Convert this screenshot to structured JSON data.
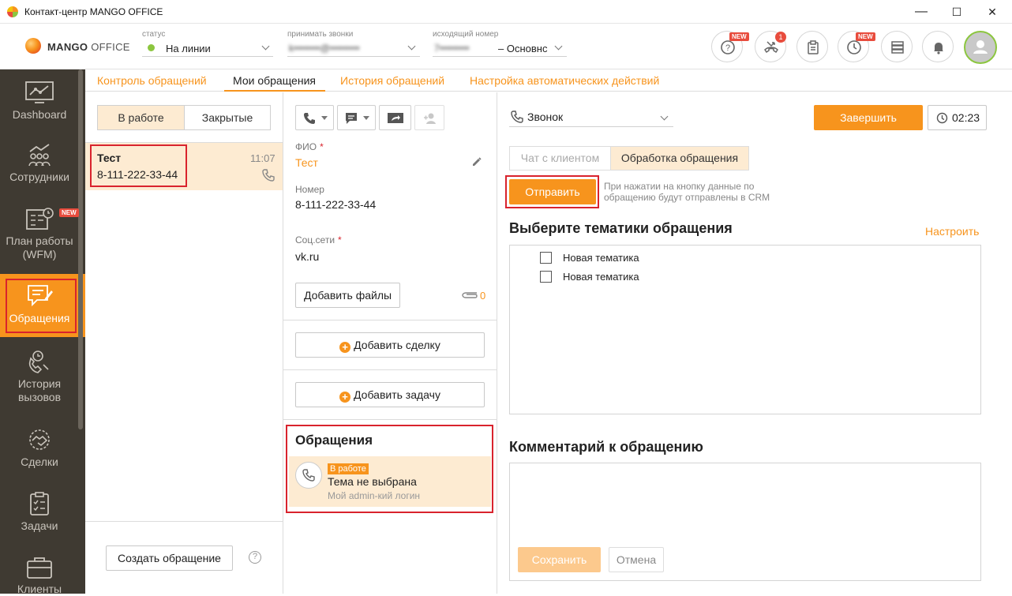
{
  "window": {
    "title": "Контакт-центр MANGO OFFICE",
    "minimize": "—",
    "maximize": "☐",
    "close": "✕"
  },
  "header": {
    "logo_brand": "MANGO",
    "logo_suffix": "OFFICE",
    "status_label": "статус",
    "status_value": "На линии",
    "status_color": "#8cc63f",
    "accept_label": "принимать звонки",
    "accept_value": "k••••••••@•••••••••",
    "outgoing_label": "исходящий номер",
    "outgoing_number": "7•••••••••",
    "outgoing_value": "– Основнс",
    "new_badge": "NEW",
    "missed_count": "1"
  },
  "sidebar": {
    "items": [
      {
        "label": "Dashboard",
        "icon": "dashboard-icon"
      },
      {
        "label": "Сотрудники",
        "icon": "employees-icon"
      },
      {
        "label": "План работы (WFM)",
        "icon": "wfm-plan-icon",
        "badge": "NEW"
      },
      {
        "label": "Обращения",
        "icon": "requests-icon",
        "active": true
      },
      {
        "label": "История вызовов",
        "icon": "call-history-icon"
      },
      {
        "label": "Сделки",
        "icon": "deals-icon"
      },
      {
        "label": "Задачи",
        "icon": "tasks-icon"
      },
      {
        "label": "Клиенты",
        "icon": "clients-icon"
      }
    ]
  },
  "tabs": [
    {
      "label": "Контроль обращений"
    },
    {
      "label": "Мои обращения",
      "active": true
    },
    {
      "label": "История обращений"
    },
    {
      "label": "Настройка автоматических действий"
    }
  ],
  "list": {
    "segment_active": "В работе",
    "segment_other": "Закрытые",
    "items": [
      {
        "name": "Тест",
        "phone": "8-111-222-33-44",
        "time": "11:07"
      }
    ],
    "create_button": "Создать обращение",
    "help": "?"
  },
  "details": {
    "fio_label": "ФИО",
    "fio_value": "Тест",
    "number_label": "Номер",
    "number_value": "8-111-222-33-44",
    "social_label": "Соц.сети",
    "social_value": "vk.ru",
    "add_files": "Добавить файлы",
    "files_count": "0",
    "add_deal": "Добавить сделку",
    "add_task": "Добавить задачу",
    "requests_title": "Обращения",
    "request_status": "В работе",
    "request_topic": "Тема не выбрана",
    "request_owner": "Мой admin-кий логин",
    "required_mark": "*"
  },
  "right": {
    "channel": "Звонок",
    "finish_button": "Завершить",
    "timer": "02:23",
    "tab_chat": "Чат с клиентом",
    "tab_processing": "Обработка обращения",
    "send_button": "Отправить",
    "send_hint_line1": "При нажатии на кнопку данные по",
    "send_hint_line2": "обращению будут отправлены в CRM",
    "topics_title": "Выберите тематики обращения",
    "topics_config": "Настроить",
    "topics": [
      "Новая тематика",
      "Новая тематика"
    ],
    "comment_title": "Комментарий к обращению",
    "save_button": "Сохранить",
    "cancel_button": "Отмена"
  },
  "colors": {
    "accent": "#f7941d",
    "sidebar": "#3f3a32",
    "highlight": "#fdebd2",
    "annotation": "#d9232d"
  }
}
